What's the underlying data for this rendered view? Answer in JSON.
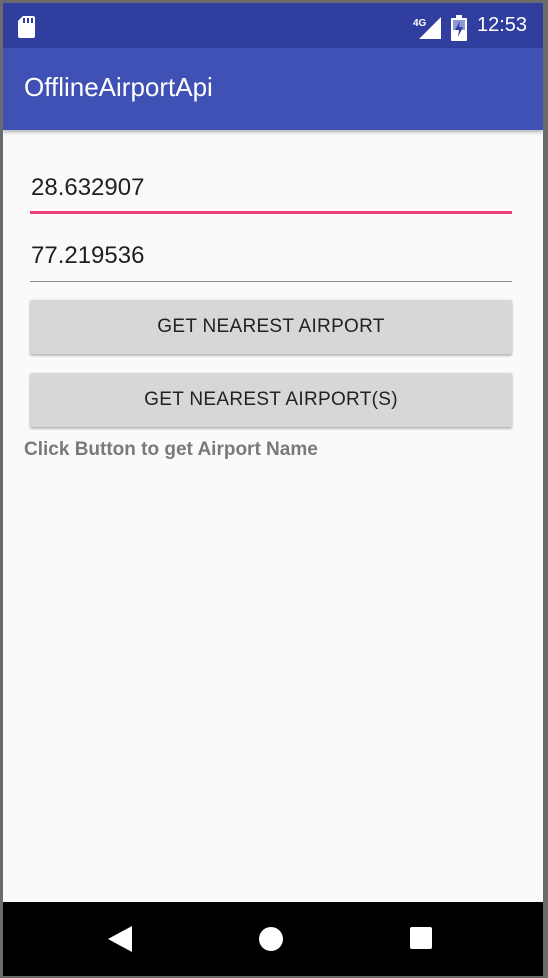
{
  "status_bar": {
    "network_label": "4G",
    "time": "12:53",
    "icons": [
      "sd-card-icon",
      "signal-icon",
      "battery-charging-icon"
    ]
  },
  "app_bar": {
    "title": "OfflineAirportApi"
  },
  "form": {
    "latitude_value": "28.632907",
    "longitude_value": "77.219536"
  },
  "buttons": {
    "nearest_label": "GET NEAREST AIRPORT",
    "nearest_multi_label": "GET NEAREST AIRPORT(S)"
  },
  "result": {
    "text": "Click Button to get Airport Name"
  },
  "nav_bar": {
    "icons": [
      "back-icon",
      "home-icon",
      "recents-icon"
    ]
  },
  "colors": {
    "status_bar": "#303f9f",
    "app_bar": "#3f51b5",
    "accent": "#ec407a",
    "button": "#d6d7d7",
    "background": "#fafafa"
  }
}
